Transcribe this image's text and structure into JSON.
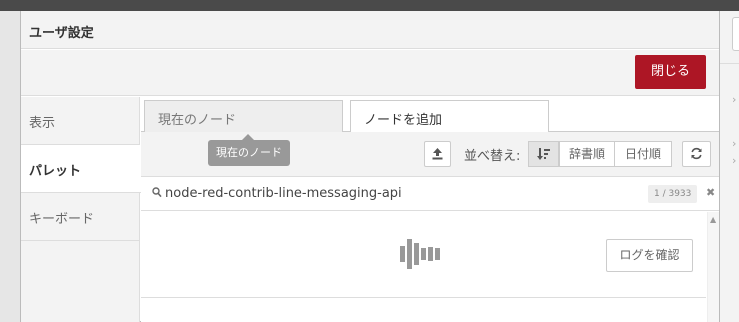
{
  "dialog": {
    "title": "ユーザ設定",
    "close_label": "閉じる"
  },
  "sidebar": {
    "items": [
      {
        "label": "表示",
        "active": false
      },
      {
        "label": "パレット",
        "active": true
      },
      {
        "label": "キーボード",
        "active": false
      }
    ]
  },
  "tabs": [
    {
      "label": "現在のノード",
      "active": false
    },
    {
      "label": "ノードを追加",
      "active": true
    }
  ],
  "tooltip": "現在のノード",
  "toolbar": {
    "upload_icon": "upload-icon",
    "sort_label": "並べ替え:",
    "sort_options": [
      {
        "label": "",
        "icon": "sort-icon",
        "selected": true
      },
      {
        "label": "辞書順",
        "selected": false
      },
      {
        "label": "日付順",
        "selected": false
      }
    ],
    "refresh_icon": "refresh-icon"
  },
  "search": {
    "value": "node-red-contrib-line-messaging-api",
    "count": "1 / 3933"
  },
  "results": {
    "loading": true,
    "log_button_label": "ログを確認"
  },
  "colors": {
    "accent": "#ad1625",
    "panel": "#f3f3f3"
  }
}
